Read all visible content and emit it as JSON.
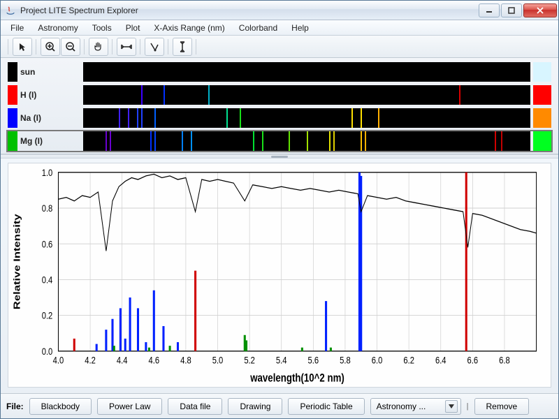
{
  "window": {
    "title": "Project LITE Spectrum Explorer"
  },
  "menu": {
    "items": [
      "File",
      "Astronomy",
      "Tools",
      "Plot",
      "X-Axis Range (nm)",
      "Colorband",
      "Help"
    ]
  },
  "toolbar": {
    "icons": [
      "pointer",
      "zoom-in",
      "zoom-out",
      "pan-hand",
      "x-zoom",
      "crosshair",
      "y-zoom"
    ]
  },
  "tracks": [
    {
      "name": "sun",
      "swatch": "#000000",
      "end": "#d8f5ff",
      "type": "continuous"
    },
    {
      "name": "H (I)",
      "swatch": "#ff0000",
      "end": "#ff0000",
      "type": "emission",
      "lines": [
        {
          "pos": 13,
          "color": "#3c00ff"
        },
        {
          "pos": 18,
          "color": "#0030ff"
        },
        {
          "pos": 28,
          "color": "#00b0c8"
        },
        {
          "pos": 84,
          "color": "#d80000"
        }
      ]
    },
    {
      "name": "Na (I)",
      "swatch": "#0000ff",
      "end": "#ff8a00",
      "type": "emission",
      "lines": [
        {
          "pos": 8,
          "color": "#4020ff"
        },
        {
          "pos": 10,
          "color": "#4020ff"
        },
        {
          "pos": 12,
          "color": "#2040ff"
        },
        {
          "pos": 13,
          "color": "#2040ff"
        },
        {
          "pos": 16,
          "color": "#0060ff"
        },
        {
          "pos": 32,
          "color": "#00e090"
        },
        {
          "pos": 35,
          "color": "#18e018"
        },
        {
          "pos": 60,
          "color": "#ffe000"
        },
        {
          "pos": 62,
          "color": "#ffe000"
        },
        {
          "pos": 66,
          "color": "#ffb000"
        }
      ]
    },
    {
      "name": "Mg (I)",
      "swatch": "#00c000",
      "end": "#00ff20",
      "type": "emission",
      "selected": true,
      "lines": [
        {
          "pos": 5,
          "color": "#6a00d0"
        },
        {
          "pos": 6,
          "color": "#6a00d0"
        },
        {
          "pos": 15,
          "color": "#0030ff"
        },
        {
          "pos": 16,
          "color": "#0040ff"
        },
        {
          "pos": 22,
          "color": "#0080ff"
        },
        {
          "pos": 24,
          "color": "#0090ff"
        },
        {
          "pos": 38,
          "color": "#00e030"
        },
        {
          "pos": 40,
          "color": "#18e018"
        },
        {
          "pos": 46,
          "color": "#60e000"
        },
        {
          "pos": 50,
          "color": "#a0e000"
        },
        {
          "pos": 55,
          "color": "#e0e000"
        },
        {
          "pos": 56,
          "color": "#e0d000"
        },
        {
          "pos": 62,
          "color": "#ffc000"
        },
        {
          "pos": 63,
          "color": "#ffb000"
        },
        {
          "pos": 92,
          "color": "#d00000"
        },
        {
          "pos": 93.5,
          "color": "#c00000"
        }
      ]
    }
  ],
  "chart_data": {
    "type": "line+bar",
    "title": "",
    "xlabel": "wavelength(10^2 nm)",
    "ylabel": "Relative Intensity",
    "xlim": [
      4.0,
      7.0
    ],
    "ylim": [
      0.0,
      1.0
    ],
    "xticks": [
      4.0,
      4.2,
      4.4,
      4.6,
      4.8,
      5.0,
      5.2,
      5.4,
      5.6,
      5.8,
      6.0,
      6.2,
      6.4,
      6.6,
      6.8
    ],
    "yticks": [
      0.0,
      0.2,
      0.4,
      0.6,
      0.8,
      1.0
    ],
    "series_curve": {
      "name": "sun",
      "color": "#000000",
      "x": [
        4.0,
        4.05,
        4.1,
        4.15,
        4.2,
        4.25,
        4.3,
        4.34,
        4.38,
        4.42,
        4.46,
        4.5,
        4.55,
        4.6,
        4.65,
        4.7,
        4.75,
        4.8,
        4.86,
        4.9,
        4.95,
        5.0,
        5.05,
        5.1,
        5.17,
        5.22,
        5.28,
        5.34,
        5.4,
        5.46,
        5.52,
        5.58,
        5.64,
        5.7,
        5.76,
        5.82,
        5.88,
        5.9,
        5.94,
        6.0,
        6.06,
        6.12,
        6.18,
        6.24,
        6.3,
        6.36,
        6.42,
        6.48,
        6.54,
        6.57,
        6.6,
        6.66,
        6.72,
        6.78,
        6.84,
        6.9,
        6.96,
        7.0
      ],
      "y": [
        0.85,
        0.86,
        0.84,
        0.87,
        0.86,
        0.89,
        0.56,
        0.84,
        0.92,
        0.95,
        0.97,
        0.96,
        0.98,
        0.99,
        0.97,
        0.98,
        0.96,
        0.97,
        0.78,
        0.96,
        0.95,
        0.96,
        0.95,
        0.94,
        0.84,
        0.93,
        0.92,
        0.91,
        0.92,
        0.91,
        0.9,
        0.91,
        0.9,
        0.89,
        0.9,
        0.89,
        0.88,
        0.78,
        0.87,
        0.86,
        0.85,
        0.86,
        0.84,
        0.83,
        0.82,
        0.81,
        0.8,
        0.79,
        0.78,
        0.58,
        0.77,
        0.76,
        0.74,
        0.72,
        0.7,
        0.68,
        0.67,
        0.66
      ]
    },
    "series_bars": [
      {
        "name": "H",
        "color": "#d00000",
        "points": [
          {
            "x": 4.1,
            "y": 0.07
          },
          {
            "x": 4.34,
            "y": 0.12
          },
          {
            "x": 4.86,
            "y": 0.45
          },
          {
            "x": 6.56,
            "y": 1.0
          }
        ]
      },
      {
        "name": "Na",
        "color": "#0020ff",
        "points": [
          {
            "x": 4.24,
            "y": 0.04
          },
          {
            "x": 4.3,
            "y": 0.12
          },
          {
            "x": 4.34,
            "y": 0.18
          },
          {
            "x": 4.39,
            "y": 0.24
          },
          {
            "x": 4.42,
            "y": 0.07
          },
          {
            "x": 4.45,
            "y": 0.3
          },
          {
            "x": 4.5,
            "y": 0.24
          },
          {
            "x": 4.55,
            "y": 0.05
          },
          {
            "x": 4.6,
            "y": 0.34
          },
          {
            "x": 4.66,
            "y": 0.14
          },
          {
            "x": 4.75,
            "y": 0.05
          },
          {
            "x": 5.68,
            "y": 0.28
          },
          {
            "x": 5.89,
            "y": 1.0
          },
          {
            "x": 5.9,
            "y": 0.98
          }
        ]
      },
      {
        "name": "Mg",
        "color": "#009000",
        "points": [
          {
            "x": 4.35,
            "y": 0.03
          },
          {
            "x": 4.57,
            "y": 0.02
          },
          {
            "x": 4.7,
            "y": 0.03
          },
          {
            "x": 5.17,
            "y": 0.09
          },
          {
            "x": 5.18,
            "y": 0.06
          },
          {
            "x": 5.53,
            "y": 0.02
          },
          {
            "x": 5.71,
            "y": 0.02
          }
        ]
      }
    ]
  },
  "bottom": {
    "file_label": "File:",
    "buttons": [
      "Blackbody",
      "Power Law",
      "Data file",
      "Drawing",
      "Periodic Table"
    ],
    "combo_value": "Astronomy ...",
    "divider": "|",
    "remove": "Remove"
  }
}
